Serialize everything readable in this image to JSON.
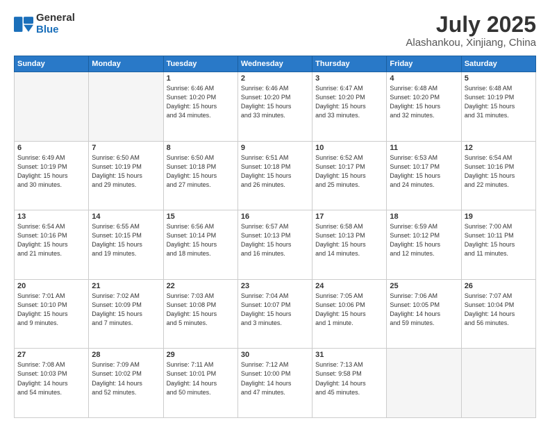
{
  "header": {
    "logo_general": "General",
    "logo_blue": "Blue",
    "month_year": "July 2025",
    "location": "Alashankou, Xinjiang, China"
  },
  "days_of_week": [
    "Sunday",
    "Monday",
    "Tuesday",
    "Wednesday",
    "Thursday",
    "Friday",
    "Saturday"
  ],
  "weeks": [
    [
      {
        "day": "",
        "info": ""
      },
      {
        "day": "",
        "info": ""
      },
      {
        "day": "1",
        "info": "Sunrise: 6:46 AM\nSunset: 10:20 PM\nDaylight: 15 hours\nand 34 minutes."
      },
      {
        "day": "2",
        "info": "Sunrise: 6:46 AM\nSunset: 10:20 PM\nDaylight: 15 hours\nand 33 minutes."
      },
      {
        "day": "3",
        "info": "Sunrise: 6:47 AM\nSunset: 10:20 PM\nDaylight: 15 hours\nand 33 minutes."
      },
      {
        "day": "4",
        "info": "Sunrise: 6:48 AM\nSunset: 10:20 PM\nDaylight: 15 hours\nand 32 minutes."
      },
      {
        "day": "5",
        "info": "Sunrise: 6:48 AM\nSunset: 10:19 PM\nDaylight: 15 hours\nand 31 minutes."
      }
    ],
    [
      {
        "day": "6",
        "info": "Sunrise: 6:49 AM\nSunset: 10:19 PM\nDaylight: 15 hours\nand 30 minutes."
      },
      {
        "day": "7",
        "info": "Sunrise: 6:50 AM\nSunset: 10:19 PM\nDaylight: 15 hours\nand 29 minutes."
      },
      {
        "day": "8",
        "info": "Sunrise: 6:50 AM\nSunset: 10:18 PM\nDaylight: 15 hours\nand 27 minutes."
      },
      {
        "day": "9",
        "info": "Sunrise: 6:51 AM\nSunset: 10:18 PM\nDaylight: 15 hours\nand 26 minutes."
      },
      {
        "day": "10",
        "info": "Sunrise: 6:52 AM\nSunset: 10:17 PM\nDaylight: 15 hours\nand 25 minutes."
      },
      {
        "day": "11",
        "info": "Sunrise: 6:53 AM\nSunset: 10:17 PM\nDaylight: 15 hours\nand 24 minutes."
      },
      {
        "day": "12",
        "info": "Sunrise: 6:54 AM\nSunset: 10:16 PM\nDaylight: 15 hours\nand 22 minutes."
      }
    ],
    [
      {
        "day": "13",
        "info": "Sunrise: 6:54 AM\nSunset: 10:16 PM\nDaylight: 15 hours\nand 21 minutes."
      },
      {
        "day": "14",
        "info": "Sunrise: 6:55 AM\nSunset: 10:15 PM\nDaylight: 15 hours\nand 19 minutes."
      },
      {
        "day": "15",
        "info": "Sunrise: 6:56 AM\nSunset: 10:14 PM\nDaylight: 15 hours\nand 18 minutes."
      },
      {
        "day": "16",
        "info": "Sunrise: 6:57 AM\nSunset: 10:13 PM\nDaylight: 15 hours\nand 16 minutes."
      },
      {
        "day": "17",
        "info": "Sunrise: 6:58 AM\nSunset: 10:13 PM\nDaylight: 15 hours\nand 14 minutes."
      },
      {
        "day": "18",
        "info": "Sunrise: 6:59 AM\nSunset: 10:12 PM\nDaylight: 15 hours\nand 12 minutes."
      },
      {
        "day": "19",
        "info": "Sunrise: 7:00 AM\nSunset: 10:11 PM\nDaylight: 15 hours\nand 11 minutes."
      }
    ],
    [
      {
        "day": "20",
        "info": "Sunrise: 7:01 AM\nSunset: 10:10 PM\nDaylight: 15 hours\nand 9 minutes."
      },
      {
        "day": "21",
        "info": "Sunrise: 7:02 AM\nSunset: 10:09 PM\nDaylight: 15 hours\nand 7 minutes."
      },
      {
        "day": "22",
        "info": "Sunrise: 7:03 AM\nSunset: 10:08 PM\nDaylight: 15 hours\nand 5 minutes."
      },
      {
        "day": "23",
        "info": "Sunrise: 7:04 AM\nSunset: 10:07 PM\nDaylight: 15 hours\nand 3 minutes."
      },
      {
        "day": "24",
        "info": "Sunrise: 7:05 AM\nSunset: 10:06 PM\nDaylight: 15 hours\nand 1 minute."
      },
      {
        "day": "25",
        "info": "Sunrise: 7:06 AM\nSunset: 10:05 PM\nDaylight: 14 hours\nand 59 minutes."
      },
      {
        "day": "26",
        "info": "Sunrise: 7:07 AM\nSunset: 10:04 PM\nDaylight: 14 hours\nand 56 minutes."
      }
    ],
    [
      {
        "day": "27",
        "info": "Sunrise: 7:08 AM\nSunset: 10:03 PM\nDaylight: 14 hours\nand 54 minutes."
      },
      {
        "day": "28",
        "info": "Sunrise: 7:09 AM\nSunset: 10:02 PM\nDaylight: 14 hours\nand 52 minutes."
      },
      {
        "day": "29",
        "info": "Sunrise: 7:11 AM\nSunset: 10:01 PM\nDaylight: 14 hours\nand 50 minutes."
      },
      {
        "day": "30",
        "info": "Sunrise: 7:12 AM\nSunset: 10:00 PM\nDaylight: 14 hours\nand 47 minutes."
      },
      {
        "day": "31",
        "info": "Sunrise: 7:13 AM\nSunset: 9:58 PM\nDaylight: 14 hours\nand 45 minutes."
      },
      {
        "day": "",
        "info": ""
      },
      {
        "day": "",
        "info": ""
      }
    ]
  ]
}
